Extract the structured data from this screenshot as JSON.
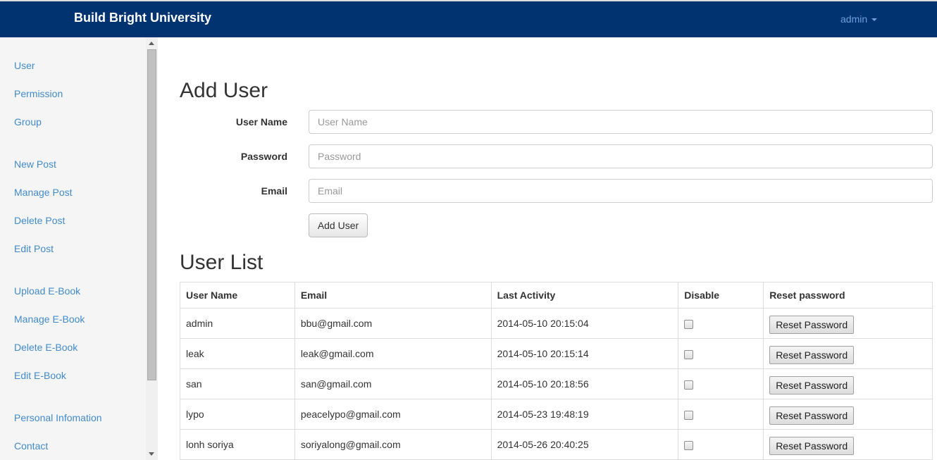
{
  "navbar": {
    "brand": "Build Bright University",
    "user_menu": "admin"
  },
  "sidebar": {
    "groups": [
      [
        "User",
        "Permission",
        "Group"
      ],
      [
        "New Post",
        "Manage Post",
        "Delete Post",
        "Edit Post"
      ],
      [
        "Upload E-Book",
        "Manage E-Book",
        "Delete E-Book",
        "Edit E-Book"
      ],
      [
        "Personal Infomation",
        "Contact"
      ]
    ]
  },
  "add_user": {
    "heading": "Add User",
    "username_label": "User Name",
    "username_placeholder": "User Name",
    "username_value": "",
    "password_label": "Password",
    "password_placeholder": "Password",
    "password_value": "",
    "email_label": "Email",
    "email_placeholder": "Email",
    "email_value": "",
    "submit_label": "Add User"
  },
  "user_list": {
    "heading": "User List",
    "columns": [
      "User Name",
      "Email",
      "Last Activity",
      "Disable",
      "Reset password"
    ],
    "reset_label": "Reset Password",
    "rows": [
      {
        "username": "admin",
        "email": "bbu@gmail.com",
        "last_activity": "2014-05-10 20:15:04",
        "disabled": false
      },
      {
        "username": "leak",
        "email": "leak@gmail.com",
        "last_activity": "2014-05-10 20:15:14",
        "disabled": false
      },
      {
        "username": "san",
        "email": "san@gmail.com",
        "last_activity": "2014-05-10 20:18:56",
        "disabled": false
      },
      {
        "username": "lypo",
        "email": "peacelypo@gmail.com",
        "last_activity": "2014-05-23 19:48:19",
        "disabled": false
      },
      {
        "username": "lonh soriya",
        "email": "soriyalong@gmail.com",
        "last_activity": "2014-05-26 20:40:25",
        "disabled": false
      }
    ]
  }
}
